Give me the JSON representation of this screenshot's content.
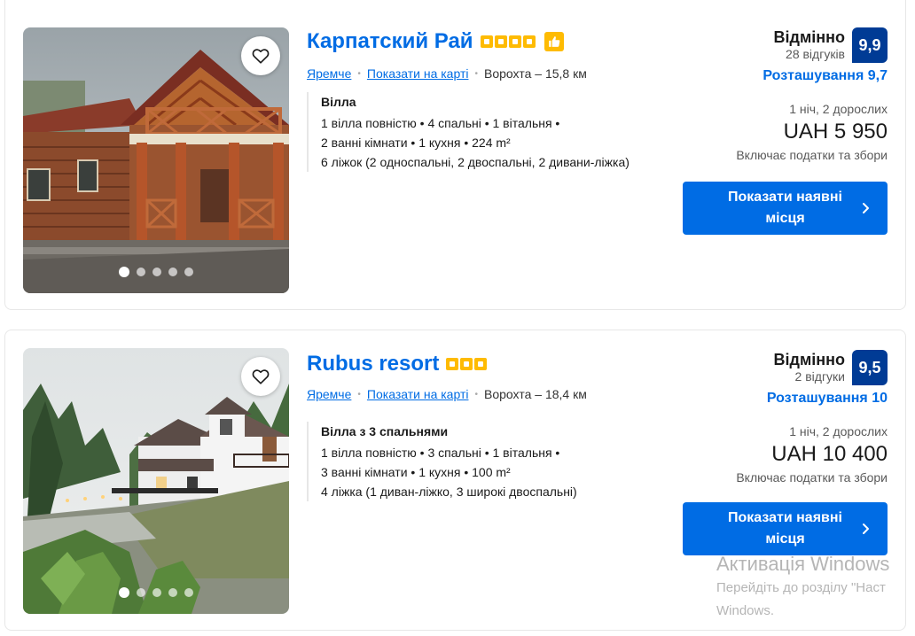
{
  "listings": [
    {
      "name": "Карпатский Рай",
      "stars": 4,
      "town": "Яремче",
      "map_link": "Показати на карті",
      "distance": "Ворохта – 15,8 км",
      "room_name": "Вілла",
      "details": [
        "1 вілла повністю • 4 спальні • 1 вітальня •",
        "2 ванні кімнати • 1 кухня • 224 m²",
        "6 ліжок (2 односпальні, 2 двоспальні, 2 дивани-ліжка)"
      ],
      "rating_word": "Відмінно",
      "reviews": "28 відгуків",
      "score": "9,9",
      "location_score": "Розташування 9,7",
      "nights_guests": "1 ніч, 2 дорослих",
      "price": "UAH 5 950",
      "taxes": "Включає податки та збори",
      "button": "Показати наявні місця"
    },
    {
      "name": "Rubus resort",
      "stars": 3,
      "town": "Яремче",
      "map_link": "Показати на карті",
      "distance": "Ворохта – 18,4 км",
      "room_name": "Вілла з 3 спальнями",
      "details": [
        "1 вілла повністю • 3 спальні • 1 вітальня •",
        "3 ванні кімнати • 1 кухня • 100 m²",
        "4 ліжка (1 диван-ліжко, 3 широкі двоспальні)"
      ],
      "rating_word": "Відмінно",
      "reviews": "2 відгуки",
      "score": "9,5",
      "location_score": "Розташування 10",
      "nights_guests": "1 ніч, 2 дорослих",
      "price": "UAH 10 400",
      "taxes": "Включає податки та збори",
      "button": "Показати наявні місця"
    }
  ],
  "watermark": {
    "title": "Активація Windows",
    "line1": "Перейдіть до розділу \"Наст",
    "line2": "Windows."
  },
  "colors": {
    "link": "#006ce4",
    "score_bg": "#003b95",
    "star": "#febb02",
    "button": "#006ce4"
  },
  "icons": {
    "favorite": "heart-outline-icon",
    "chevron": "chevron-right-icon",
    "badge": "thumbs-up-icon"
  }
}
